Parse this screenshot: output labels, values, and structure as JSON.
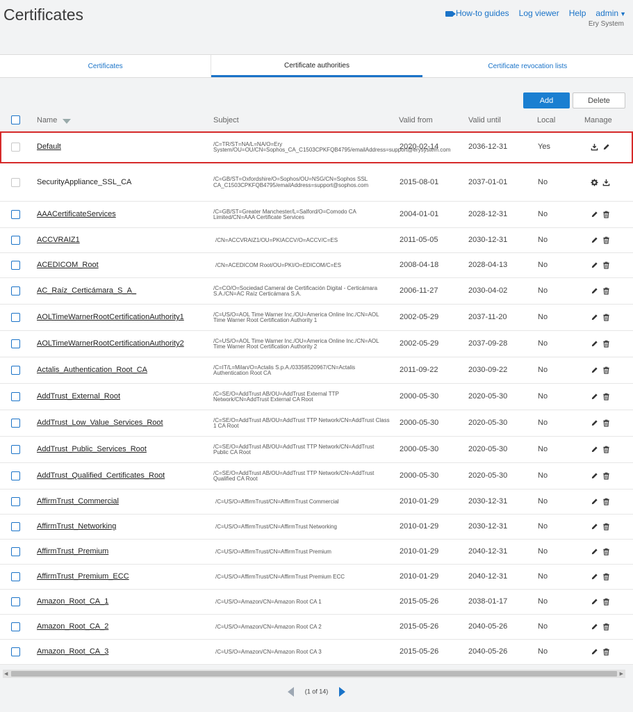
{
  "page": {
    "title": "Certificates"
  },
  "topnav": {
    "howto": "How-to guides",
    "logviewer": "Log viewer",
    "help": "Help",
    "user": "admin",
    "device": "Ery System"
  },
  "tabs": [
    "Certificates",
    "Certificate authorities",
    "Certificate revocation lists"
  ],
  "actions": {
    "add": "Add",
    "delete": "Delete"
  },
  "columns": {
    "name": "Name",
    "subject": "Subject",
    "valid_from": "Valid from",
    "valid_until": "Valid until",
    "local": "Local",
    "manage": "Manage"
  },
  "rows": [
    {
      "name": "Default",
      "subject": "/C=TR/ST=NA/L=NA/O=Ery System/OU=OU/CN=Sophos_CA_C1503CPKFQB4795/emailAddress=support@erysystem.com",
      "from": "2020-02-14",
      "until": "2036-12-31",
      "local": "Yes"
    },
    {
      "name": "SecurityAppliance_SSL_CA",
      "subject": "/C=GB/ST=Oxfordshire/O=Sophos/OU=NSG/CN=Sophos SSL CA_C1503CPKFQB4795/emailAddress=support@sophos.com",
      "from": "2015-08-01",
      "until": "2037-01-01",
      "local": "No"
    },
    {
      "name": "AAACertificateServices",
      "subject": "/C=GB/ST=Greater Manchester/L=Salford/O=Comodo CA Limited/CN=AAA Certificate Services",
      "from": "2004-01-01",
      "until": "2028-12-31",
      "local": "No"
    },
    {
      "name": "ACCVRAIZ1",
      "subject": "/CN=ACCVRAIZ1/OU=PKIACCV/O=ACCV/C=ES",
      "from": "2011-05-05",
      "until": "2030-12-31",
      "local": "No"
    },
    {
      "name": "ACEDICOM_Root",
      "subject": "/CN=ACEDICOM Root/OU=PKI/O=EDICOM/C=ES",
      "from": "2008-04-18",
      "until": "2028-04-13",
      "local": "No"
    },
    {
      "name": "AC_Raíz_Certicámara_S_A_",
      "subject": "/C=CO/O=Sociedad Cameral de Certificación Digital - Certicámara S.A./CN=AC Raíz Certicámara S.A.",
      "from": "2006-11-27",
      "until": "2030-04-02",
      "local": "No"
    },
    {
      "name": "AOLTimeWarnerRootCertificationAuthority1",
      "subject": "/C=US/O=AOL Time Warner Inc./OU=America Online Inc./CN=AOL Time Warner Root Certification Authority 1",
      "from": "2002-05-29",
      "until": "2037-11-20",
      "local": "No"
    },
    {
      "name": "AOLTimeWarnerRootCertificationAuthority2",
      "subject": "/C=US/O=AOL Time Warner Inc./OU=America Online Inc./CN=AOL Time Warner Root Certification Authority 2",
      "from": "2002-05-29",
      "until": "2037-09-28",
      "local": "No"
    },
    {
      "name": "Actalis_Authentication_Root_CA",
      "subject": "/C=IT/L=Milan/O=Actalis S.p.A./03358520967/CN=Actalis Authentication Root CA",
      "from": "2011-09-22",
      "until": "2030-09-22",
      "local": "No"
    },
    {
      "name": "AddTrust_External_Root",
      "subject": "/C=SE/O=AddTrust AB/OU=AddTrust External TTP Network/CN=AddTrust External CA Root",
      "from": "2000-05-30",
      "until": "2020-05-30",
      "local": "No"
    },
    {
      "name": "AddTrust_Low_Value_Services_Root",
      "subject": "/C=SE/O=AddTrust AB/OU=AddTrust TTP Network/CN=AddTrust Class 1 CA Root",
      "from": "2000-05-30",
      "until": "2020-05-30",
      "local": "No"
    },
    {
      "name": "AddTrust_Public_Services_Root",
      "subject": "/C=SE/O=AddTrust AB/OU=AddTrust TTP Network/CN=AddTrust Public CA Root",
      "from": "2000-05-30",
      "until": "2020-05-30",
      "local": "No"
    },
    {
      "name": "AddTrust_Qualified_Certificates_Root",
      "subject": "/C=SE/O=AddTrust AB/OU=AddTrust TTP Network/CN=AddTrust Qualified CA Root",
      "from": "2000-05-30",
      "until": "2020-05-30",
      "local": "No"
    },
    {
      "name": "AffirmTrust_Commercial",
      "subject": "/C=US/O=AffirmTrust/CN=AffirmTrust Commercial",
      "from": "2010-01-29",
      "until": "2030-12-31",
      "local": "No"
    },
    {
      "name": "AffirmTrust_Networking",
      "subject": "/C=US/O=AffirmTrust/CN=AffirmTrust Networking",
      "from": "2010-01-29",
      "until": "2030-12-31",
      "local": "No"
    },
    {
      "name": "AffirmTrust_Premium",
      "subject": "/C=US/O=AffirmTrust/CN=AffirmTrust Premium",
      "from": "2010-01-29",
      "until": "2040-12-31",
      "local": "No"
    },
    {
      "name": "AffirmTrust_Premium_ECC",
      "subject": "/C=US/O=AffirmTrust/CN=AffirmTrust Premium ECC",
      "from": "2010-01-29",
      "until": "2040-12-31",
      "local": "No"
    },
    {
      "name": "Amazon_Root_CA_1",
      "subject": "/C=US/O=Amazon/CN=Amazon Root CA 1",
      "from": "2015-05-26",
      "until": "2038-01-17",
      "local": "No"
    },
    {
      "name": "Amazon_Root_CA_2",
      "subject": "/C=US/O=Amazon/CN=Amazon Root CA 2",
      "from": "2015-05-26",
      "until": "2040-05-26",
      "local": "No"
    },
    {
      "name": "Amazon_Root_CA_3",
      "subject": "/C=US/O=Amazon/CN=Amazon Root CA 3",
      "from": "2015-05-26",
      "until": "2040-05-26",
      "local": "No"
    }
  ],
  "pager": {
    "text": "(1 of 14)"
  }
}
